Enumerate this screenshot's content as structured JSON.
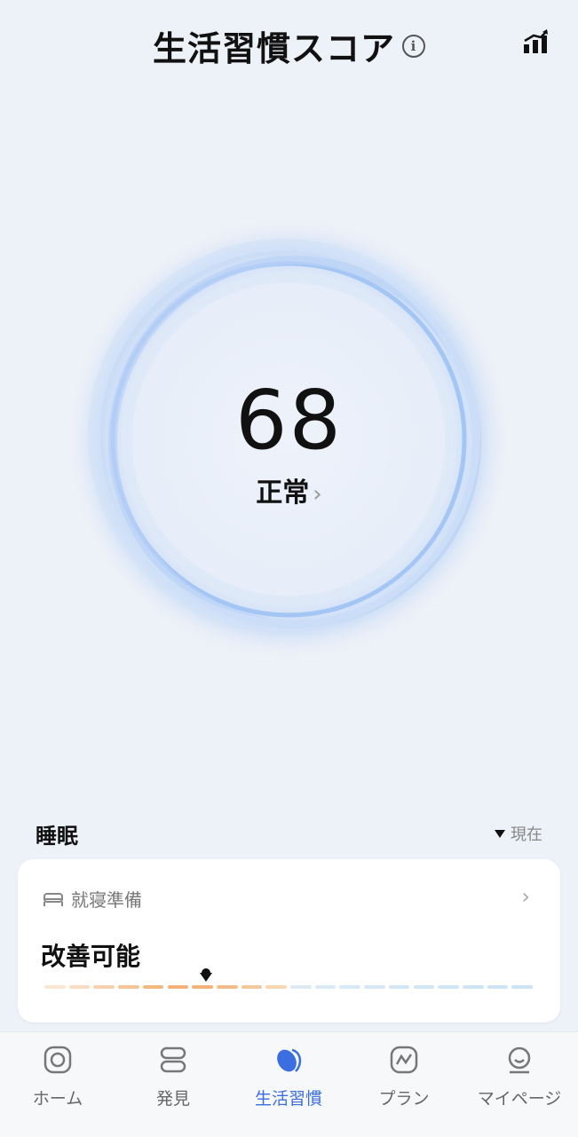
{
  "header": {
    "title": "生活習慣スコア",
    "info_icon": "info-icon",
    "stats_icon": "bar-chart-trend-icon"
  },
  "score": {
    "value": "68",
    "status": "正常",
    "chevron": "›"
  },
  "sleep": {
    "section_title": "睡眠",
    "legend_now": "現在",
    "card": {
      "category": "就寝準備",
      "category_icon": "bed-icon",
      "value": "改善可能",
      "chevron": "›",
      "position": 0.33
    }
  },
  "tabs": [
    {
      "label": "ホーム",
      "icon": "home-icon",
      "active": false
    },
    {
      "label": "発見",
      "icon": "discover-icon",
      "active": false
    },
    {
      "label": "生活習慣",
      "icon": "lifestyle-icon",
      "active": true
    },
    {
      "label": "プラン",
      "icon": "plan-icon",
      "active": false
    },
    {
      "label": "マイページ",
      "icon": "profile-icon",
      "active": false
    }
  ],
  "colors": {
    "accent": "#3b6ee0",
    "ring": "#a9c8f5",
    "bar_orange": "#f2b27a",
    "bar_blue": "#cde4f5"
  }
}
